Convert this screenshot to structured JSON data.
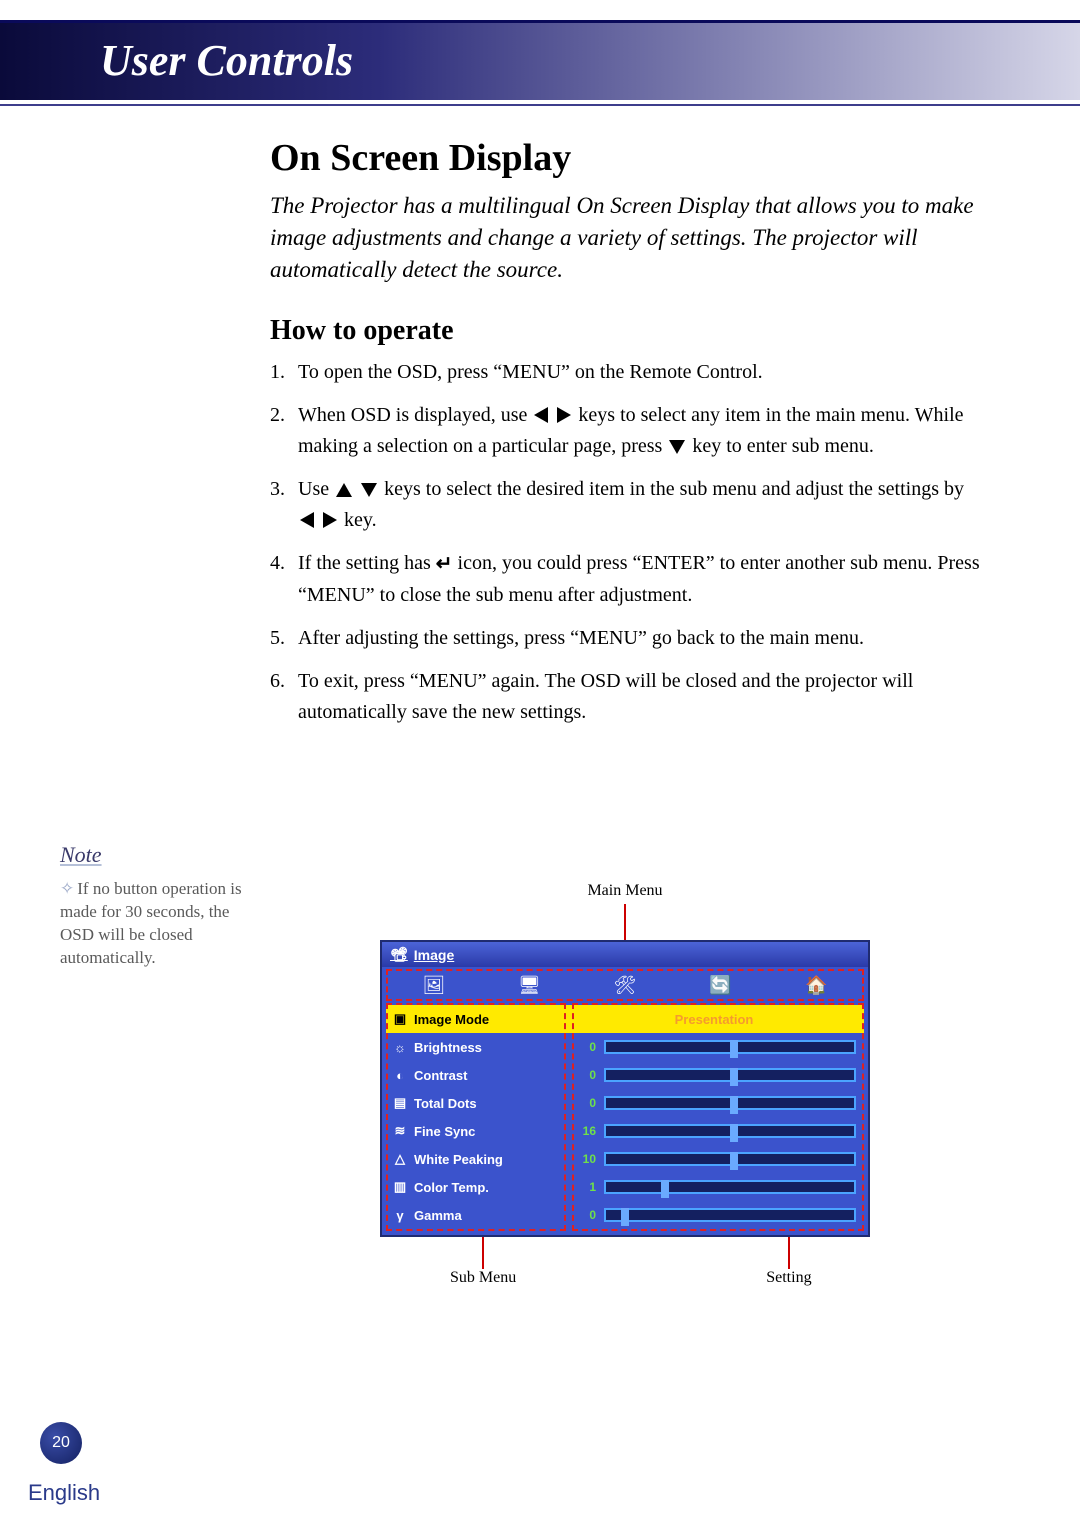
{
  "chapter_title": "User Controls",
  "section_title": "On Screen Display",
  "intro": "The Projector has a multilingual On Screen Display that allows you to make image adjustments and change a variety of settings. The projector will automatically detect the source.",
  "subsection": "How to operate",
  "steps": {
    "s1": "To open the OSD, press “MENU” on the Remote Control.",
    "s2a": "When OSD is displayed, use ",
    "s2b": " keys to select any item in the main menu. While making a selection on a particular page, press ",
    "s2c": " key to enter sub menu.",
    "s3a": "Use ",
    "s3b": " keys to select the desired item in the sub menu and adjust the settings by ",
    "s3c": " key.",
    "s4a": "If the setting has ",
    "s4b": " icon, you could press “ENTER” to enter another sub menu. Press “MENU” to close the sub menu after adjustment.",
    "s5": "After adjusting the settings, press “MENU” go back to the main menu.",
    "s6": "To exit, press “MENU” again. The OSD will be closed and the projector will automatically save the new settings."
  },
  "note": {
    "label": "Note",
    "text": "If no button operation is made for 30 seconds, the OSD will be closed automatically."
  },
  "callouts": {
    "main_menu": "Main Menu",
    "sub_menu": "Sub Menu",
    "setting": "Setting"
  },
  "osd": {
    "title": "Image",
    "tabs": [
      "image-icon",
      "screen-icon",
      "lamp-icon",
      "setup-icon",
      "option-icon"
    ],
    "rows": [
      {
        "label": "Image Mode",
        "value_text": "Presentation",
        "highlight": true
      },
      {
        "label": "Brightness",
        "value": 0,
        "slider_pct": 50
      },
      {
        "label": "Contrast",
        "value": 0,
        "slider_pct": 50
      },
      {
        "label": "Total Dots",
        "value": 0,
        "slider_pct": 50
      },
      {
        "label": "Fine Sync",
        "value": 16,
        "slider_pct": 50
      },
      {
        "label": "White Peaking",
        "value": 10,
        "slider_pct": 50
      },
      {
        "label": "Color Temp.",
        "value": 1,
        "slider_pct": 22
      },
      {
        "label": "Gamma",
        "value": 0,
        "slider_pct": 6
      }
    ]
  },
  "page_number": "20",
  "language": "English"
}
